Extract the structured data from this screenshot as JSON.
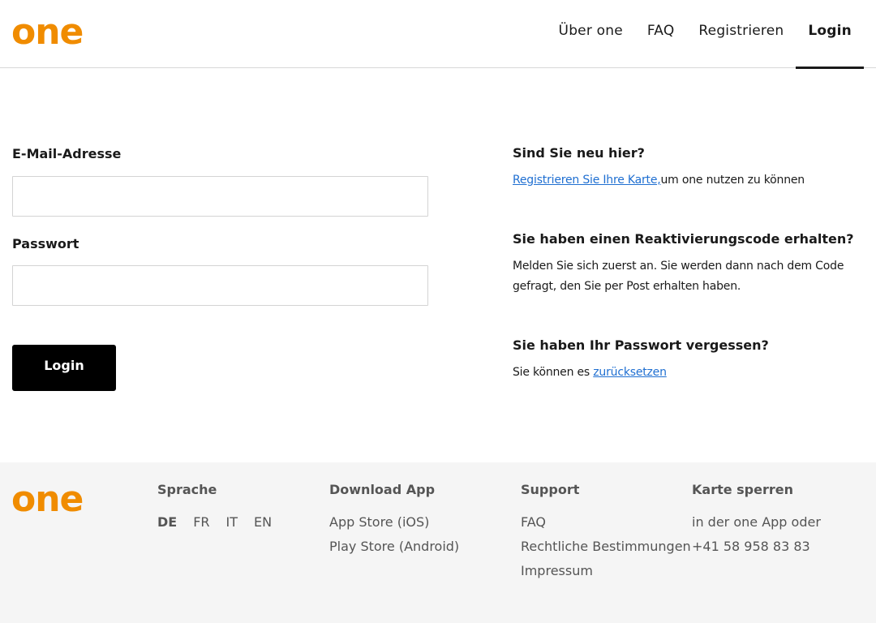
{
  "header": {
    "logo": "one",
    "nav": [
      {
        "label": "Über one"
      },
      {
        "label": "FAQ"
      },
      {
        "label": "Registrieren"
      },
      {
        "label": "Login"
      }
    ]
  },
  "login": {
    "email_label": "E-Mail-Adresse",
    "email_value": "",
    "password_label": "Passwort",
    "password_value": "",
    "button_label": "Login"
  },
  "info": {
    "new_title": "Sind Sie neu hier?",
    "new_link": "Registrieren Sie Ihre Karte,",
    "new_text": "um one nutzen zu können",
    "reactivation_title": "Sie haben einen Reaktivierungscode erhalten?",
    "reactivation_text": "Melden Sie sich zuerst an. Sie werden dann nach dem Code gefragt, den Sie per Post erhalten haben.",
    "forgot_title": "Sie haben Ihr Passwort vergessen?",
    "forgot_text": "Sie können es ",
    "forgot_link": "zurücksetzen"
  },
  "footer": {
    "logo": "one",
    "language": {
      "title": "Sprache",
      "options": [
        "DE",
        "FR",
        "IT",
        "EN"
      ],
      "selected": "DE"
    },
    "download": {
      "title": "Download App",
      "links": [
        "App Store (iOS)",
        "Play Store (Android)"
      ]
    },
    "support": {
      "title": "Support",
      "links": [
        "FAQ",
        "Rechtliche Bestimmungen",
        "Impressum"
      ]
    },
    "block_card": {
      "title": "Karte sperren",
      "lines": [
        "in der one App oder",
        "+41 58 958 83 83"
      ]
    }
  },
  "colors": {
    "brand": "#f08c00",
    "link": "#1f6fd1",
    "button": "#000000",
    "footer_bg": "#f5f5f5"
  }
}
